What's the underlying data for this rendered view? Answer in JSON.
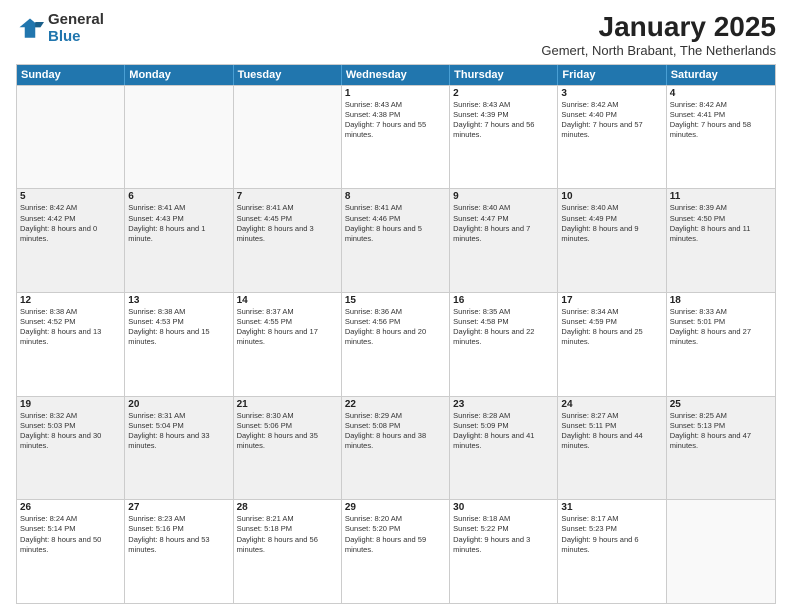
{
  "logo": {
    "general": "General",
    "blue": "Blue"
  },
  "title": "January 2025",
  "subtitle": "Gemert, North Brabant, The Netherlands",
  "days": [
    "Sunday",
    "Monday",
    "Tuesday",
    "Wednesday",
    "Thursday",
    "Friday",
    "Saturday"
  ],
  "weeks": [
    [
      {
        "day": "",
        "sunrise": "",
        "sunset": "",
        "daylight": "",
        "empty": true
      },
      {
        "day": "",
        "sunrise": "",
        "sunset": "",
        "daylight": "",
        "empty": true
      },
      {
        "day": "",
        "sunrise": "",
        "sunset": "",
        "daylight": "",
        "empty": true
      },
      {
        "day": "1",
        "sunrise": "Sunrise: 8:43 AM",
        "sunset": "Sunset: 4:38 PM",
        "daylight": "Daylight: 7 hours and 55 minutes."
      },
      {
        "day": "2",
        "sunrise": "Sunrise: 8:43 AM",
        "sunset": "Sunset: 4:39 PM",
        "daylight": "Daylight: 7 hours and 56 minutes."
      },
      {
        "day": "3",
        "sunrise": "Sunrise: 8:42 AM",
        "sunset": "Sunset: 4:40 PM",
        "daylight": "Daylight: 7 hours and 57 minutes."
      },
      {
        "day": "4",
        "sunrise": "Sunrise: 8:42 AM",
        "sunset": "Sunset: 4:41 PM",
        "daylight": "Daylight: 7 hours and 58 minutes."
      }
    ],
    [
      {
        "day": "5",
        "sunrise": "Sunrise: 8:42 AM",
        "sunset": "Sunset: 4:42 PM",
        "daylight": "Daylight: 8 hours and 0 minutes."
      },
      {
        "day": "6",
        "sunrise": "Sunrise: 8:41 AM",
        "sunset": "Sunset: 4:43 PM",
        "daylight": "Daylight: 8 hours and 1 minute."
      },
      {
        "day": "7",
        "sunrise": "Sunrise: 8:41 AM",
        "sunset": "Sunset: 4:45 PM",
        "daylight": "Daylight: 8 hours and 3 minutes."
      },
      {
        "day": "8",
        "sunrise": "Sunrise: 8:41 AM",
        "sunset": "Sunset: 4:46 PM",
        "daylight": "Daylight: 8 hours and 5 minutes."
      },
      {
        "day": "9",
        "sunrise": "Sunrise: 8:40 AM",
        "sunset": "Sunset: 4:47 PM",
        "daylight": "Daylight: 8 hours and 7 minutes."
      },
      {
        "day": "10",
        "sunrise": "Sunrise: 8:40 AM",
        "sunset": "Sunset: 4:49 PM",
        "daylight": "Daylight: 8 hours and 9 minutes."
      },
      {
        "day": "11",
        "sunrise": "Sunrise: 8:39 AM",
        "sunset": "Sunset: 4:50 PM",
        "daylight": "Daylight: 8 hours and 11 minutes."
      }
    ],
    [
      {
        "day": "12",
        "sunrise": "Sunrise: 8:38 AM",
        "sunset": "Sunset: 4:52 PM",
        "daylight": "Daylight: 8 hours and 13 minutes."
      },
      {
        "day": "13",
        "sunrise": "Sunrise: 8:38 AM",
        "sunset": "Sunset: 4:53 PM",
        "daylight": "Daylight: 8 hours and 15 minutes."
      },
      {
        "day": "14",
        "sunrise": "Sunrise: 8:37 AM",
        "sunset": "Sunset: 4:55 PM",
        "daylight": "Daylight: 8 hours and 17 minutes."
      },
      {
        "day": "15",
        "sunrise": "Sunrise: 8:36 AM",
        "sunset": "Sunset: 4:56 PM",
        "daylight": "Daylight: 8 hours and 20 minutes."
      },
      {
        "day": "16",
        "sunrise": "Sunrise: 8:35 AM",
        "sunset": "Sunset: 4:58 PM",
        "daylight": "Daylight: 8 hours and 22 minutes."
      },
      {
        "day": "17",
        "sunrise": "Sunrise: 8:34 AM",
        "sunset": "Sunset: 4:59 PM",
        "daylight": "Daylight: 8 hours and 25 minutes."
      },
      {
        "day": "18",
        "sunrise": "Sunrise: 8:33 AM",
        "sunset": "Sunset: 5:01 PM",
        "daylight": "Daylight: 8 hours and 27 minutes."
      }
    ],
    [
      {
        "day": "19",
        "sunrise": "Sunrise: 8:32 AM",
        "sunset": "Sunset: 5:03 PM",
        "daylight": "Daylight: 8 hours and 30 minutes."
      },
      {
        "day": "20",
        "sunrise": "Sunrise: 8:31 AM",
        "sunset": "Sunset: 5:04 PM",
        "daylight": "Daylight: 8 hours and 33 minutes."
      },
      {
        "day": "21",
        "sunrise": "Sunrise: 8:30 AM",
        "sunset": "Sunset: 5:06 PM",
        "daylight": "Daylight: 8 hours and 35 minutes."
      },
      {
        "day": "22",
        "sunrise": "Sunrise: 8:29 AM",
        "sunset": "Sunset: 5:08 PM",
        "daylight": "Daylight: 8 hours and 38 minutes."
      },
      {
        "day": "23",
        "sunrise": "Sunrise: 8:28 AM",
        "sunset": "Sunset: 5:09 PM",
        "daylight": "Daylight: 8 hours and 41 minutes."
      },
      {
        "day": "24",
        "sunrise": "Sunrise: 8:27 AM",
        "sunset": "Sunset: 5:11 PM",
        "daylight": "Daylight: 8 hours and 44 minutes."
      },
      {
        "day": "25",
        "sunrise": "Sunrise: 8:25 AM",
        "sunset": "Sunset: 5:13 PM",
        "daylight": "Daylight: 8 hours and 47 minutes."
      }
    ],
    [
      {
        "day": "26",
        "sunrise": "Sunrise: 8:24 AM",
        "sunset": "Sunset: 5:14 PM",
        "daylight": "Daylight: 8 hours and 50 minutes."
      },
      {
        "day": "27",
        "sunrise": "Sunrise: 8:23 AM",
        "sunset": "Sunset: 5:16 PM",
        "daylight": "Daylight: 8 hours and 53 minutes."
      },
      {
        "day": "28",
        "sunrise": "Sunrise: 8:21 AM",
        "sunset": "Sunset: 5:18 PM",
        "daylight": "Daylight: 8 hours and 56 minutes."
      },
      {
        "day": "29",
        "sunrise": "Sunrise: 8:20 AM",
        "sunset": "Sunset: 5:20 PM",
        "daylight": "Daylight: 8 hours and 59 minutes."
      },
      {
        "day": "30",
        "sunrise": "Sunrise: 8:18 AM",
        "sunset": "Sunset: 5:22 PM",
        "daylight": "Daylight: 9 hours and 3 minutes."
      },
      {
        "day": "31",
        "sunrise": "Sunrise: 8:17 AM",
        "sunset": "Sunset: 5:23 PM",
        "daylight": "Daylight: 9 hours and 6 minutes."
      },
      {
        "day": "",
        "sunrise": "",
        "sunset": "",
        "daylight": "",
        "empty": true
      }
    ]
  ]
}
